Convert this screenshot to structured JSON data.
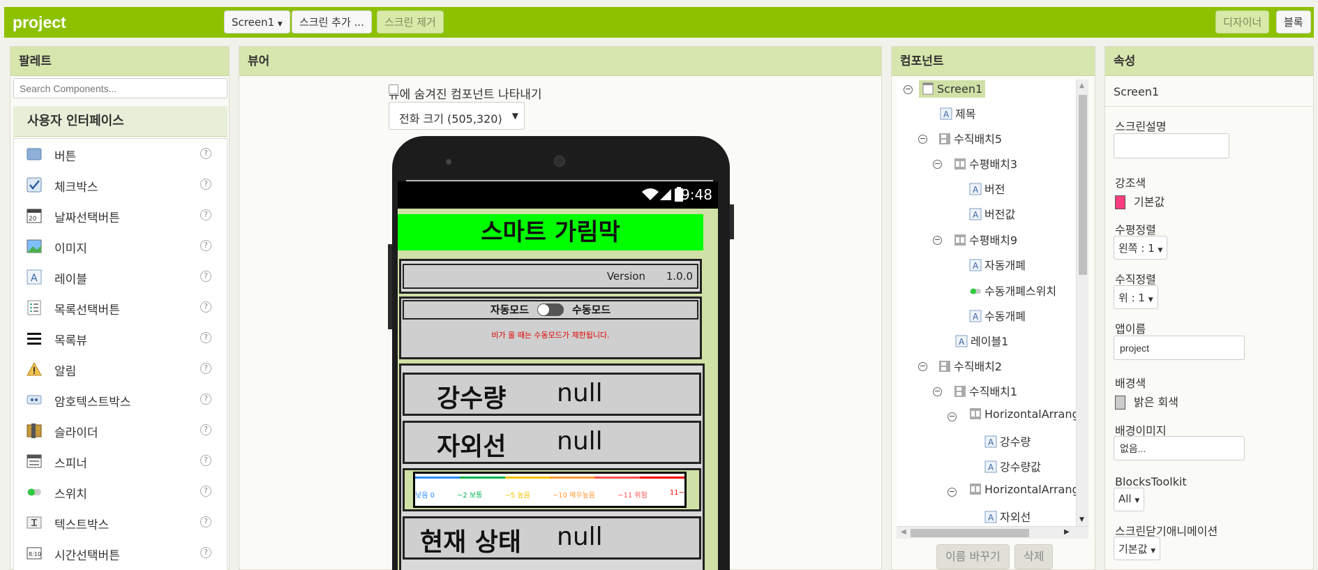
{
  "topbar": {
    "project_title": "project",
    "screen_dropdown": "Screen1",
    "add_screen": "스크린 추가 ...",
    "remove_screen": "스크린 제거",
    "designer": "디자이너",
    "blocks": "블록"
  },
  "palette": {
    "title": "팔레트",
    "search_placeholder": "Search Components...",
    "category": "사용자 인터페이스",
    "items": [
      {
        "label": "버튼",
        "icon": "button-icon"
      },
      {
        "label": "체크박스",
        "icon": "checkbox-icon"
      },
      {
        "label": "날짜선택버튼",
        "icon": "datepicker-icon"
      },
      {
        "label": "이미지",
        "icon": "image-icon"
      },
      {
        "label": "레이블",
        "icon": "label-icon"
      },
      {
        "label": "목록선택버튼",
        "icon": "listpicker-icon"
      },
      {
        "label": "목록뷰",
        "icon": "listview-icon"
      },
      {
        "label": "알림",
        "icon": "notifier-icon"
      },
      {
        "label": "암호텍스트박스",
        "icon": "password-icon"
      },
      {
        "label": "슬라이더",
        "icon": "slider-icon"
      },
      {
        "label": "스피너",
        "icon": "spinner-icon"
      },
      {
        "label": "스위치",
        "icon": "switch-icon"
      },
      {
        "label": "텍스트박스",
        "icon": "textbox-icon"
      },
      {
        "label": "시간선택버튼",
        "icon": "timepicker-icon"
      }
    ],
    "help": "?"
  },
  "viewer": {
    "title": "뷰어",
    "show_hidden": "뷰에 숨겨진 컴포넌트 나타내기",
    "size_select": "전화 크기 (505,320)",
    "phone": {
      "time": "9:48",
      "app_title": "스마트 가림막",
      "version_label": "Version",
      "version_value": "1.0.0",
      "auto_mode": "자동모드",
      "manual_mode": "수동모드",
      "warning": "비가 올 때는 수동모드가 제한됩니다.",
      "rain_label": "강수량",
      "rain_value": "null",
      "uv_label": "자외선",
      "uv_value": "null",
      "scale": [
        "낮음 0",
        "~2 보통",
        "~5 높음",
        "~10 매우높음",
        "~11 위험",
        "11~"
      ],
      "scale_colors": [
        "#2d8cff",
        "#00b050",
        "#f5c400",
        "#ff9933",
        "#ff5050",
        "#ff0000"
      ],
      "status_label": "현재 상태",
      "status_value": "null"
    }
  },
  "components": {
    "title": "컴포넌트",
    "rename": "이름 바꾸기",
    "delete": "삭제",
    "nodes": [
      "Screen1",
      "제목",
      "수직배치5",
      "수평배치3",
      "버전",
      "버전값",
      "수평배치9",
      "자동개폐",
      "수동개폐스위치",
      "수동개폐",
      "레이블1",
      "수직배치2",
      "수직배치1",
      "HorizontalArrang",
      "강수량",
      "강수량값",
      "HorizontalArrang",
      "자외선"
    ]
  },
  "properties": {
    "title": "속성",
    "component": "Screen1",
    "screen_desc_label": "스크린설명",
    "accent_label": "강조색",
    "accent_value": "기본값",
    "accent_color": "#ff3d7f",
    "halign_label": "수평정렬",
    "halign_value": "왼쪽 : 1",
    "valign_label": "수직정렬",
    "valign_value": "위 : 1",
    "appname_label": "앱이름",
    "appname_value": "project",
    "bgcolor_label": "배경색",
    "bgcolor_value": "밝은 회색",
    "bgcolor_color": "#cccccc",
    "bgimage_label": "배경이미지",
    "bgimage_value": "없음...",
    "blockstoolkit_label": "BlocksToolkit",
    "blockstoolkit_value": "All",
    "close_anim_label": "스크린닫기애니메이션",
    "close_anim_value": "기본값"
  }
}
